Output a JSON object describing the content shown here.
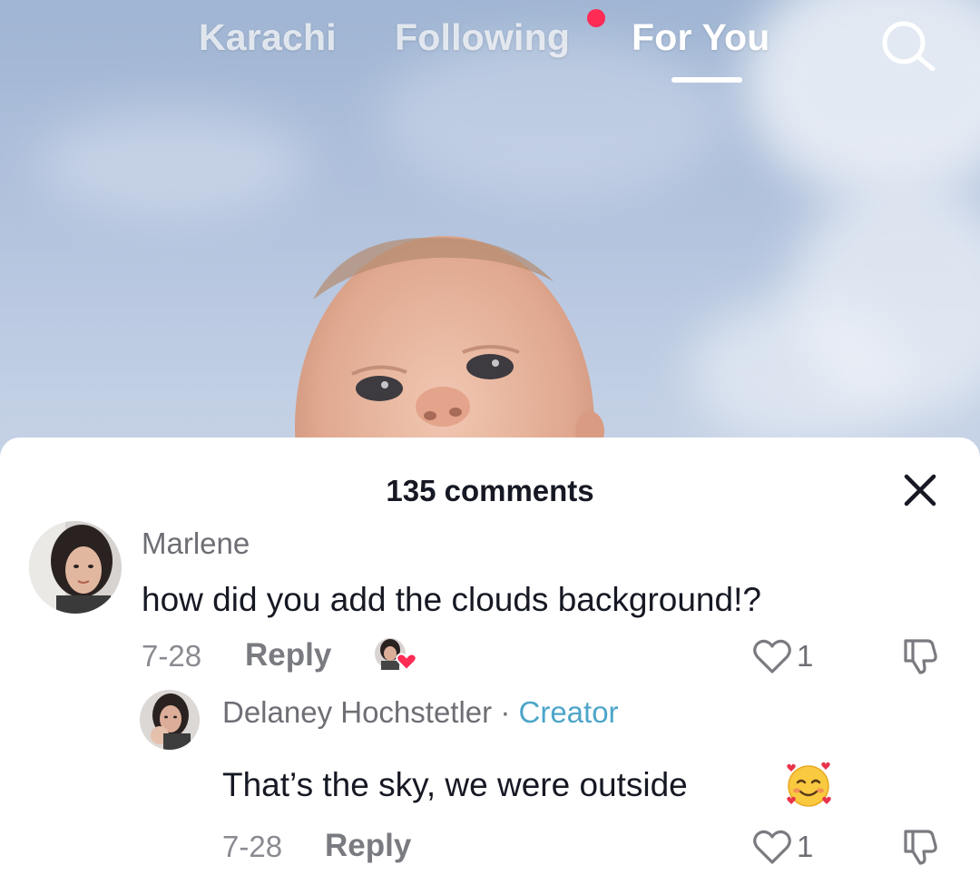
{
  "nav": {
    "tabs": [
      {
        "label": "Karachi"
      },
      {
        "label": "Following"
      },
      {
        "label": "For You"
      }
    ],
    "active_tab": "For You",
    "notification_dot_color": "#fe2c55",
    "search_icon": "search-icon"
  },
  "comments_panel": {
    "count_label": "135 comments",
    "close_icon": "close-icon",
    "comments": [
      {
        "username": "Marlene",
        "text": "how did you add the clouds background!?",
        "date": "7-28",
        "reply_label": "Reply",
        "likes": "1",
        "liked_by_creator": true
      },
      {
        "username": "Delaney Hochstetler",
        "separator": "·",
        "badge": "Creator",
        "text": "That’s the sky, we were outside",
        "emoji": "smiling-face-with-hearts",
        "date": "7-28",
        "reply_label": "Reply",
        "likes": "1"
      }
    ]
  },
  "colors": {
    "accent_red": "#fe2c55",
    "creator_badge": "#4da6c9",
    "primary_text": "#161823"
  }
}
